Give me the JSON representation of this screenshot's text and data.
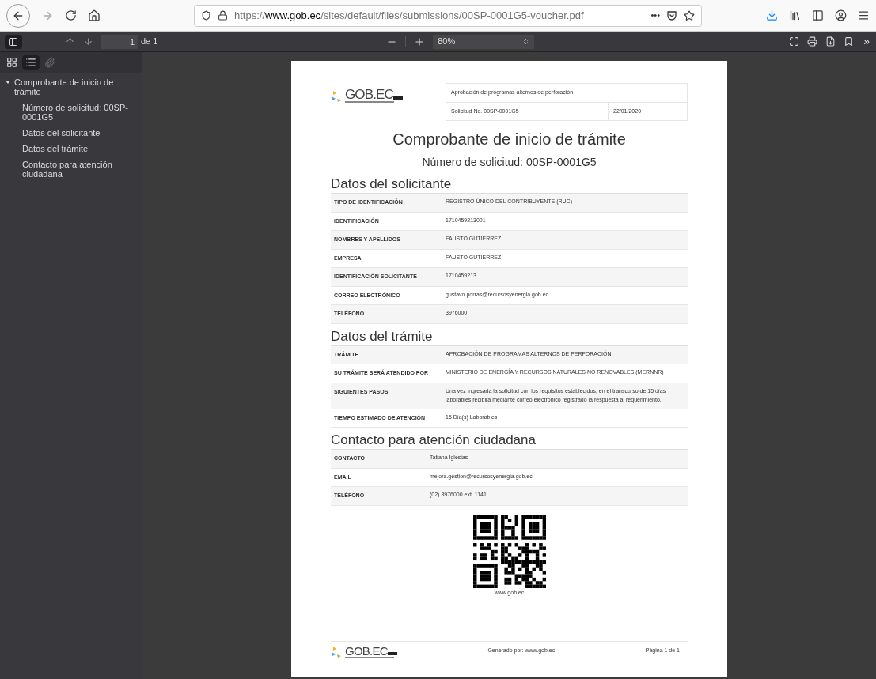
{
  "browser": {
    "url_scheme": "https://",
    "url_host": "www.gob.ec",
    "url_path": "/sites/default/files/submissions/00SP-0001G5-voucher.pdf",
    "menu_dots": "•••"
  },
  "pdf_toolbar": {
    "sidebar_open": true,
    "page_number": "1",
    "page_count": "de 1",
    "zoom": "80%",
    "more": "»"
  },
  "sidebar": {
    "views": [
      {
        "kind": "thumbnails",
        "selected": false,
        "disabled": false
      },
      {
        "kind": "outline",
        "selected": true,
        "disabled": false
      },
      {
        "kind": "attachments",
        "selected": false,
        "disabled": true
      }
    ],
    "outline": [
      {
        "label": "Comprobante de inicio de trámite",
        "expanded": true,
        "children": [
          {
            "label": "Número de solicitud: 00SP-0001G5"
          },
          {
            "label": "Datos del solicitante"
          },
          {
            "label": "Datos del trámite"
          },
          {
            "label": "Contacto para atención ciudadana"
          }
        ]
      }
    ]
  },
  "document": {
    "logo": {
      "name": "GOB.EC"
    },
    "header": {
      "procedure": "Aprobación de programas alternos de perforación",
      "request": "Solicitud No. 00SP-0001G5",
      "date": "22/01/2020"
    },
    "title": "Comprobante de inicio de trámite",
    "subtitle": "Número de solicitud: 00SP-0001G5",
    "sections": [
      {
        "heading": "Datos del solicitante",
        "rows": [
          {
            "label": "TIPO DE IDENTIFICACIÓN",
            "value": "REGISTRO ÚNICO DEL CONTRIBUYENTE (RUC)"
          },
          {
            "label": "IDENTIFICACIÓN",
            "value": "1710459213001"
          },
          {
            "label": "NOMBRES Y APELLIDOS",
            "value": "FAUSTO GUTIERREZ"
          },
          {
            "label": "EMPRESA",
            "value": "FAUSTO GUTIERREZ"
          },
          {
            "label": "IDENTIFICACIÓN SOLICITANTE",
            "value": "1710459213"
          },
          {
            "label": "CORREO ELECTRÓNICO",
            "value": "gustavo.porras@recursosyenergia.gob.ec"
          },
          {
            "label": "TELÉFONO",
            "value": "3976000"
          }
        ]
      },
      {
        "heading": "Datos del trámite",
        "rows": [
          {
            "label": "TRÁMITE",
            "value": "APROBACIÓN DE PROGRAMAS ALTERNOS DE PERFORACIÓN"
          },
          {
            "label": "SU TRÁMITE SERÁ ATENDIDO POR",
            "value": "MINISTERIO DE ENERGÍA Y RECURSOS NATURALES NO RENOVABLES (MERNNR)"
          },
          {
            "label": "SIGUIENTES PASOS",
            "value": "Una vez ingresada la solicitud con los requisitos establecidos, en el transcurso de 15 días laborables recibirá mediante correo electrónico registrado la respuesta al requerimiento."
          },
          {
            "label": "TIEMPO ESTIMADO DE ATENCIÓN",
            "value": "15 Día(s) Laborables"
          }
        ]
      },
      {
        "heading": "Contacto para atención ciudadana",
        "rows": [
          {
            "label": "CONTACTO",
            "value": "Tatiana Iglesias"
          },
          {
            "label": "EMAIL",
            "value": "mejora.gestion@recursosyenergia.gob.ec"
          },
          {
            "label": "TELÉFONO",
            "value": "(02) 3976000 ext. 1141"
          }
        ]
      }
    ],
    "qr_caption": "www.gob.ec",
    "footer": {
      "logo": {
        "name": "GOB.EC"
      },
      "generated": "Generado por: www.gob.ec",
      "page": "Página 1 de 1"
    }
  }
}
